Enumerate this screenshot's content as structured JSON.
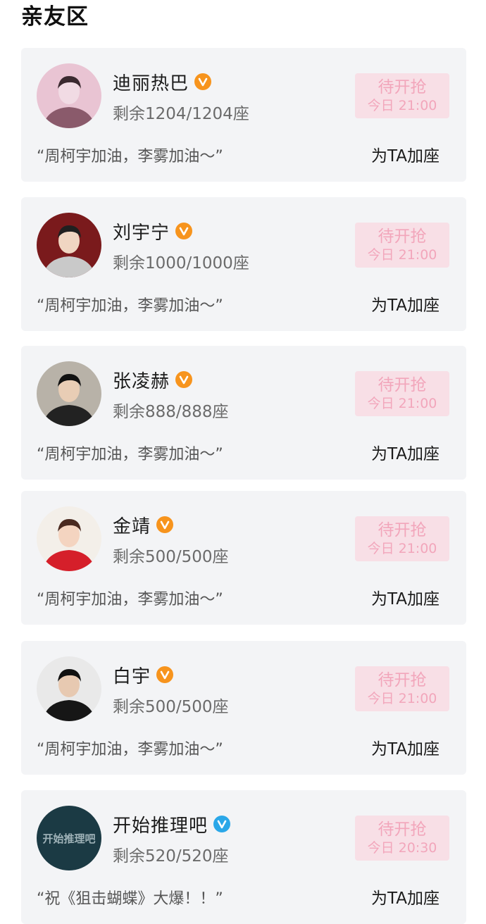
{
  "section": {
    "title": "亲友区"
  },
  "cards": [
    {
      "name": "迪丽热巴",
      "verified": "orange",
      "seats": "剩余1204/1204座",
      "button_label": "待开抢",
      "button_time": "今日 21:00",
      "quote": "“周柯宇加油，李雾加油～”",
      "action": "为TA加座",
      "avatar": "portrait-photo"
    },
    {
      "name": "刘宇宁",
      "verified": "orange",
      "seats": "剩余1000/1000座",
      "button_label": "待开抢",
      "button_time": "今日 21:00",
      "quote": "“周柯宇加油，李雾加油～”",
      "action": "为TA加座",
      "avatar": "portrait-photo"
    },
    {
      "name": "张凌赫",
      "verified": "orange",
      "seats": "剩余888/888座",
      "button_label": "待开抢",
      "button_time": "今日 21:00",
      "quote": "“周柯宇加油，李雾加油～”",
      "action": "为TA加座",
      "avatar": "portrait-photo"
    },
    {
      "name": "金靖",
      "verified": "orange",
      "seats": "剩余500/500座",
      "button_label": "待开抢",
      "button_time": "今日 21:00",
      "quote": "“周柯宇加油，李雾加油～”",
      "action": "为TA加座",
      "avatar": "portrait-photo"
    },
    {
      "name": "白宇",
      "verified": "orange",
      "seats": "剩余500/500座",
      "button_label": "待开抢",
      "button_time": "今日 21:00",
      "quote": "“周柯宇加油，李雾加油～”",
      "action": "为TA加座",
      "avatar": "portrait-photo"
    },
    {
      "name": "开始推理吧",
      "verified": "blue",
      "seats": "剩余520/520座",
      "button_label": "待开抢",
      "button_time": "今日 20:30",
      "quote": "“祝《狙击蝴蝶》大爆！！”",
      "action": "为TA加座",
      "avatar": "show-logo",
      "avatar_text": "开始推理吧"
    }
  ],
  "colors": {
    "card_bg": "#f3f4f6",
    "button_bg": "#f8dfe6",
    "button_text": "#f2a6bb",
    "badge_orange": "#f7941d",
    "badge_blue": "#2aa7e8"
  },
  "avatar_palettes": [
    [
      "#e9c4d3",
      "#8a5a6b",
      "#f1dbe4",
      "#3b2a30"
    ],
    [
      "#7a1a1c",
      "#c9c9c9",
      "#f0d6c2",
      "#202020"
    ],
    [
      "#b8b2a8",
      "#222222",
      "#e8cdb5",
      "#111111"
    ],
    [
      "#f3efe9",
      "#d51f2a",
      "#f4d4c0",
      "#4a2a20"
    ],
    [
      "#e9e9e9",
      "#161616",
      "#e7c9b1",
      "#111111"
    ],
    [
      "#1b3a44",
      "#9fb2b8",
      "#1b3a44",
      "#1b3a44"
    ]
  ]
}
